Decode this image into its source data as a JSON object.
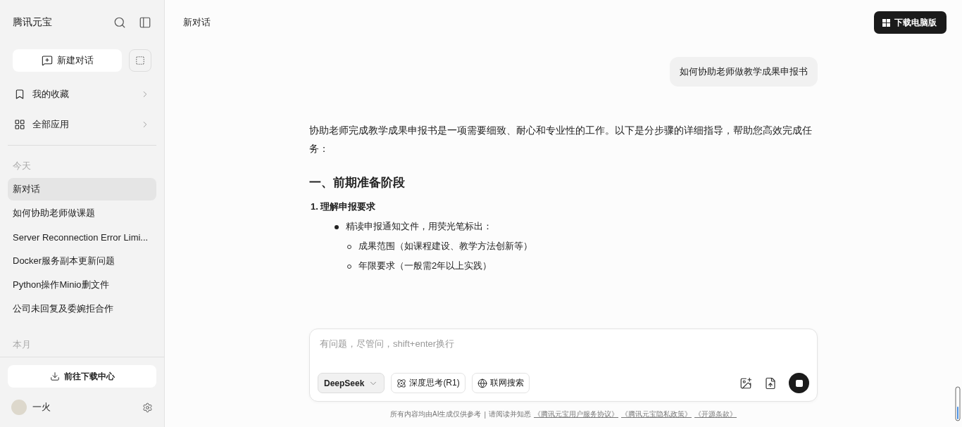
{
  "sidebar": {
    "app_title": "腾讯元宝",
    "new_chat": "新建对话",
    "menu": [
      {
        "label": "我的收藏",
        "kind": "bookmark"
      },
      {
        "label": "全部应用",
        "kind": "apps"
      }
    ],
    "sections": [
      {
        "heading": "今天",
        "items": [
          {
            "label": "新对话",
            "selected": true
          },
          {
            "label": "如何协助老师做课题",
            "selected": false
          },
          {
            "label": "Server Reconnection Error Limi...",
            "selected": false
          },
          {
            "label": "Docker服务副本更新问题",
            "selected": false
          },
          {
            "label": "Python操作Minio删文件",
            "selected": false
          },
          {
            "label": "公司未回复及委婉拒合作",
            "selected": false
          }
        ]
      },
      {
        "heading": "本月"
      }
    ],
    "download_center": "前往下载中心",
    "user": {
      "name": "一火"
    }
  },
  "header": {
    "title": "新对话",
    "download_button": "下载电脑版"
  },
  "conversation": {
    "user_message": "如何协助老师做教学成果申报书",
    "answer": [
      {
        "kind": "paragraph",
        "text": "协助老师完成教学成果申报书是一项需要细致、耐心和专业性的工作。以下是分步骤的详细指导，帮助您高效完成任务："
      },
      {
        "kind": "heading",
        "text": "一、前期准备阶段"
      },
      {
        "kind": "numbered",
        "text": "1. 理解申报要求"
      },
      {
        "kind": "bullet",
        "text": "精读申报通知文件，用荧光笔标出："
      },
      {
        "kind": "subbullet",
        "text": "成果范围（如课程建设、教学方法创新等）"
      },
      {
        "kind": "subbullet",
        "text": "年限要求（一般需2年以上实践）"
      }
    ]
  },
  "composer": {
    "placeholder": "有问题，尽管问，shift+enter换行",
    "model": "DeepSeek",
    "options": [
      {
        "label": "深度思考(R1)",
        "kind": "think",
        "selected": false
      },
      {
        "label": "联网搜索",
        "kind": "web",
        "selected": false
      }
    ]
  },
  "footer": {
    "notice": "所有内容均由AI生成仅供参考",
    "separator": "|",
    "prefix": "请阅读并知悉",
    "links": [
      "《腾讯元宝用户服务协议》",
      "《腾讯元宝隐私政策》",
      "《开源条款》"
    ]
  }
}
